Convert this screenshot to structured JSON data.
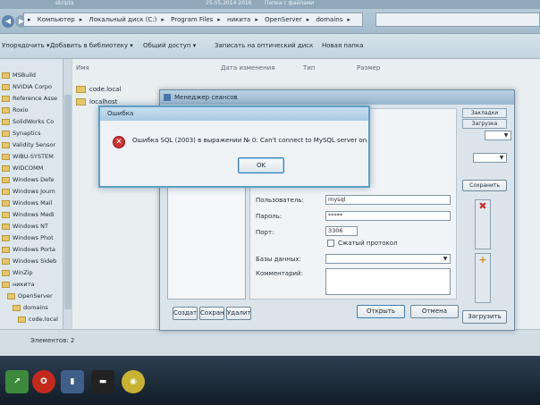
{
  "window": {
    "title_tab": "skripta",
    "title_date": "25.05.2014 2016",
    "title_extra": "Папка с файлами"
  },
  "address": {
    "crumbs": [
      "Компьютер",
      "Локальный диск (C:)",
      "Program Files",
      "никита",
      "OpenServer",
      "domains"
    ]
  },
  "toolbar": {
    "organize": "Упорядочить ▾",
    "library": "Добавить в библиотеку ▾",
    "share": "Общий доступ ▾",
    "burn": "Записать на оптический диск",
    "new_folder": "Новая папка"
  },
  "nav": {
    "items": [
      "MSBuild",
      "NVIDIA Corpo",
      "Reference Asse",
      "Roxio",
      "SolidWorks Co",
      "Synaptics",
      "Validity Sensor",
      "WIBU-SYSTEM",
      "WIDCOMM",
      "Windows Defe",
      "Windows Journ",
      "Windows Mail",
      "Windows Medi",
      "Windows NT",
      "Windows Phot",
      "Windows Porta",
      "Windows Sideb",
      "WinZip",
      "никита",
      "OpenServer",
      "domains",
      "code.local"
    ]
  },
  "content": {
    "col_name": "Имя",
    "col_date": "Дата изменения",
    "col_type": "Тип",
    "col_size": "Размер",
    "files": [
      "code.local",
      "localhost"
    ]
  },
  "status": {
    "count": "Элементов: 2"
  },
  "session_manager": {
    "title": "Менеджер сеансов",
    "tab_right": "Закладки",
    "tab_right2": "Загрузка",
    "side_button": "Сохранить",
    "user_label": "Пользователь:",
    "user_value": "mysql",
    "password_label": "Пароль:",
    "password_value": "*****",
    "port_label": "Порт:",
    "port_value": "3306",
    "compress_label": "Сжатый протокол",
    "db_label": "Базы данных:",
    "comment_label": "Комментарий:",
    "btn_create": "Создать",
    "btn_save": "Сохранить",
    "btn_delete": "Удалить",
    "btn_open": "Открыть",
    "btn_cancel": "Отмена",
    "btn_load": "Загрузить"
  },
  "error": {
    "title": "Ошибка",
    "message": "Ошибка SQL (2003) в выражении № 0: Can't connect to MySQL server on '127.0.0.1' (10061)",
    "ok": "OK"
  }
}
